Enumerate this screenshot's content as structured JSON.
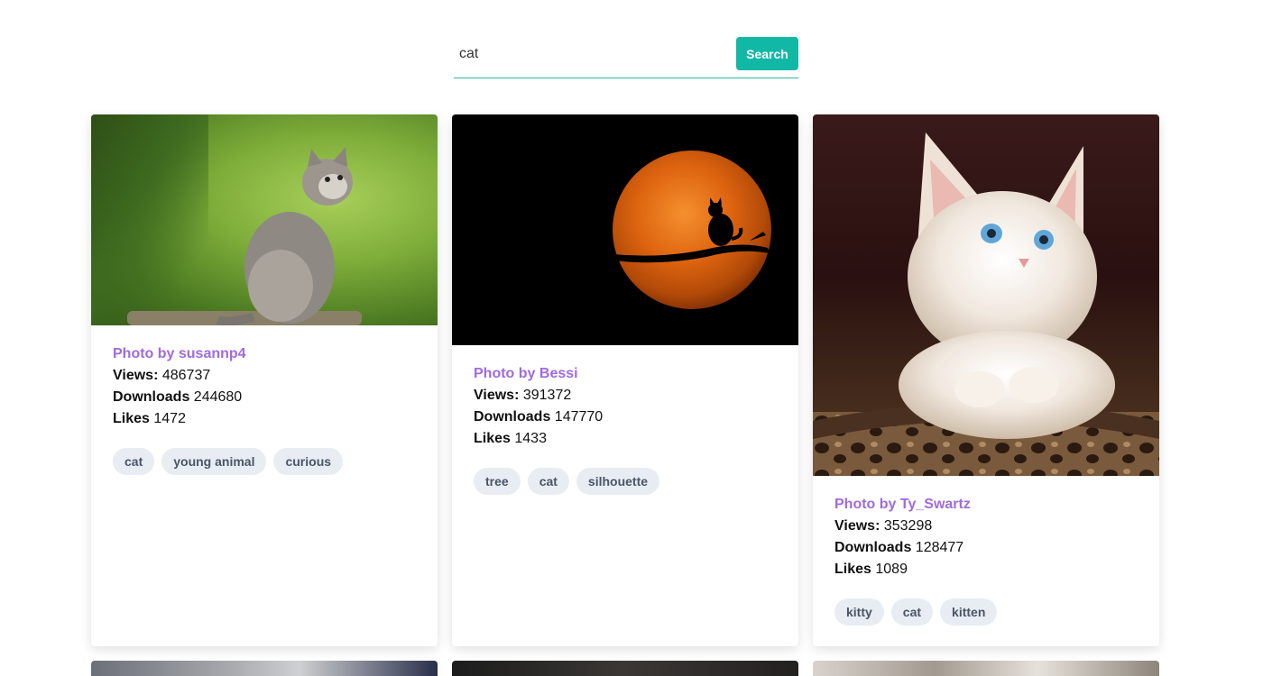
{
  "search": {
    "value": "cat",
    "button_label": "Search"
  },
  "colors": {
    "accent": "#12b8a6",
    "author": "#a06ae0",
    "tag_bg": "#e8edf3"
  },
  "cards": [
    {
      "author": "Photo by susannp4",
      "views_label": "Views:",
      "views": "486737",
      "downloads_label": "Downloads",
      "downloads": "244680",
      "likes_label": "Likes",
      "likes": "1472",
      "tags": [
        "cat",
        "young animal",
        "curious"
      ]
    },
    {
      "author": "Photo by Bessi",
      "views_label": "Views:",
      "views": "391372",
      "downloads_label": "Downloads",
      "downloads": "147770",
      "likes_label": "Likes",
      "likes": "1433",
      "tags": [
        "tree",
        "cat",
        "silhouette"
      ]
    },
    {
      "author": "Photo by Ty_Swartz",
      "views_label": "Views:",
      "views": "353298",
      "downloads_label": "Downloads",
      "downloads": "128477",
      "likes_label": "Likes",
      "likes": "1089",
      "tags": [
        "kitty",
        "cat",
        "kitten"
      ]
    }
  ]
}
